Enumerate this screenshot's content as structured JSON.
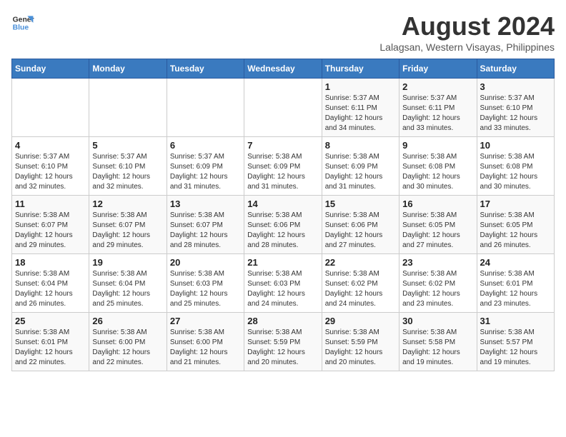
{
  "logo": {
    "line1": "General",
    "line2": "Blue"
  },
  "title": "August 2024",
  "location": "Lalagsan, Western Visayas, Philippines",
  "days_header": [
    "Sunday",
    "Monday",
    "Tuesday",
    "Wednesday",
    "Thursday",
    "Friday",
    "Saturday"
  ],
  "weeks": [
    [
      {
        "day": "",
        "info": ""
      },
      {
        "day": "",
        "info": ""
      },
      {
        "day": "",
        "info": ""
      },
      {
        "day": "",
        "info": ""
      },
      {
        "day": "1",
        "info": "Sunrise: 5:37 AM\nSunset: 6:11 PM\nDaylight: 12 hours\nand 34 minutes."
      },
      {
        "day": "2",
        "info": "Sunrise: 5:37 AM\nSunset: 6:11 PM\nDaylight: 12 hours\nand 33 minutes."
      },
      {
        "day": "3",
        "info": "Sunrise: 5:37 AM\nSunset: 6:10 PM\nDaylight: 12 hours\nand 33 minutes."
      }
    ],
    [
      {
        "day": "4",
        "info": "Sunrise: 5:37 AM\nSunset: 6:10 PM\nDaylight: 12 hours\nand 32 minutes."
      },
      {
        "day": "5",
        "info": "Sunrise: 5:37 AM\nSunset: 6:10 PM\nDaylight: 12 hours\nand 32 minutes."
      },
      {
        "day": "6",
        "info": "Sunrise: 5:37 AM\nSunset: 6:09 PM\nDaylight: 12 hours\nand 31 minutes."
      },
      {
        "day": "7",
        "info": "Sunrise: 5:38 AM\nSunset: 6:09 PM\nDaylight: 12 hours\nand 31 minutes."
      },
      {
        "day": "8",
        "info": "Sunrise: 5:38 AM\nSunset: 6:09 PM\nDaylight: 12 hours\nand 31 minutes."
      },
      {
        "day": "9",
        "info": "Sunrise: 5:38 AM\nSunset: 6:08 PM\nDaylight: 12 hours\nand 30 minutes."
      },
      {
        "day": "10",
        "info": "Sunrise: 5:38 AM\nSunset: 6:08 PM\nDaylight: 12 hours\nand 30 minutes."
      }
    ],
    [
      {
        "day": "11",
        "info": "Sunrise: 5:38 AM\nSunset: 6:07 PM\nDaylight: 12 hours\nand 29 minutes."
      },
      {
        "day": "12",
        "info": "Sunrise: 5:38 AM\nSunset: 6:07 PM\nDaylight: 12 hours\nand 29 minutes."
      },
      {
        "day": "13",
        "info": "Sunrise: 5:38 AM\nSunset: 6:07 PM\nDaylight: 12 hours\nand 28 minutes."
      },
      {
        "day": "14",
        "info": "Sunrise: 5:38 AM\nSunset: 6:06 PM\nDaylight: 12 hours\nand 28 minutes."
      },
      {
        "day": "15",
        "info": "Sunrise: 5:38 AM\nSunset: 6:06 PM\nDaylight: 12 hours\nand 27 minutes."
      },
      {
        "day": "16",
        "info": "Sunrise: 5:38 AM\nSunset: 6:05 PM\nDaylight: 12 hours\nand 27 minutes."
      },
      {
        "day": "17",
        "info": "Sunrise: 5:38 AM\nSunset: 6:05 PM\nDaylight: 12 hours\nand 26 minutes."
      }
    ],
    [
      {
        "day": "18",
        "info": "Sunrise: 5:38 AM\nSunset: 6:04 PM\nDaylight: 12 hours\nand 26 minutes."
      },
      {
        "day": "19",
        "info": "Sunrise: 5:38 AM\nSunset: 6:04 PM\nDaylight: 12 hours\nand 25 minutes."
      },
      {
        "day": "20",
        "info": "Sunrise: 5:38 AM\nSunset: 6:03 PM\nDaylight: 12 hours\nand 25 minutes."
      },
      {
        "day": "21",
        "info": "Sunrise: 5:38 AM\nSunset: 6:03 PM\nDaylight: 12 hours\nand 24 minutes."
      },
      {
        "day": "22",
        "info": "Sunrise: 5:38 AM\nSunset: 6:02 PM\nDaylight: 12 hours\nand 24 minutes."
      },
      {
        "day": "23",
        "info": "Sunrise: 5:38 AM\nSunset: 6:02 PM\nDaylight: 12 hours\nand 23 minutes."
      },
      {
        "day": "24",
        "info": "Sunrise: 5:38 AM\nSunset: 6:01 PM\nDaylight: 12 hours\nand 23 minutes."
      }
    ],
    [
      {
        "day": "25",
        "info": "Sunrise: 5:38 AM\nSunset: 6:01 PM\nDaylight: 12 hours\nand 22 minutes."
      },
      {
        "day": "26",
        "info": "Sunrise: 5:38 AM\nSunset: 6:00 PM\nDaylight: 12 hours\nand 22 minutes."
      },
      {
        "day": "27",
        "info": "Sunrise: 5:38 AM\nSunset: 6:00 PM\nDaylight: 12 hours\nand 21 minutes."
      },
      {
        "day": "28",
        "info": "Sunrise: 5:38 AM\nSunset: 5:59 PM\nDaylight: 12 hours\nand 20 minutes."
      },
      {
        "day": "29",
        "info": "Sunrise: 5:38 AM\nSunset: 5:59 PM\nDaylight: 12 hours\nand 20 minutes."
      },
      {
        "day": "30",
        "info": "Sunrise: 5:38 AM\nSunset: 5:58 PM\nDaylight: 12 hours\nand 19 minutes."
      },
      {
        "day": "31",
        "info": "Sunrise: 5:38 AM\nSunset: 5:57 PM\nDaylight: 12 hours\nand 19 minutes."
      }
    ]
  ]
}
